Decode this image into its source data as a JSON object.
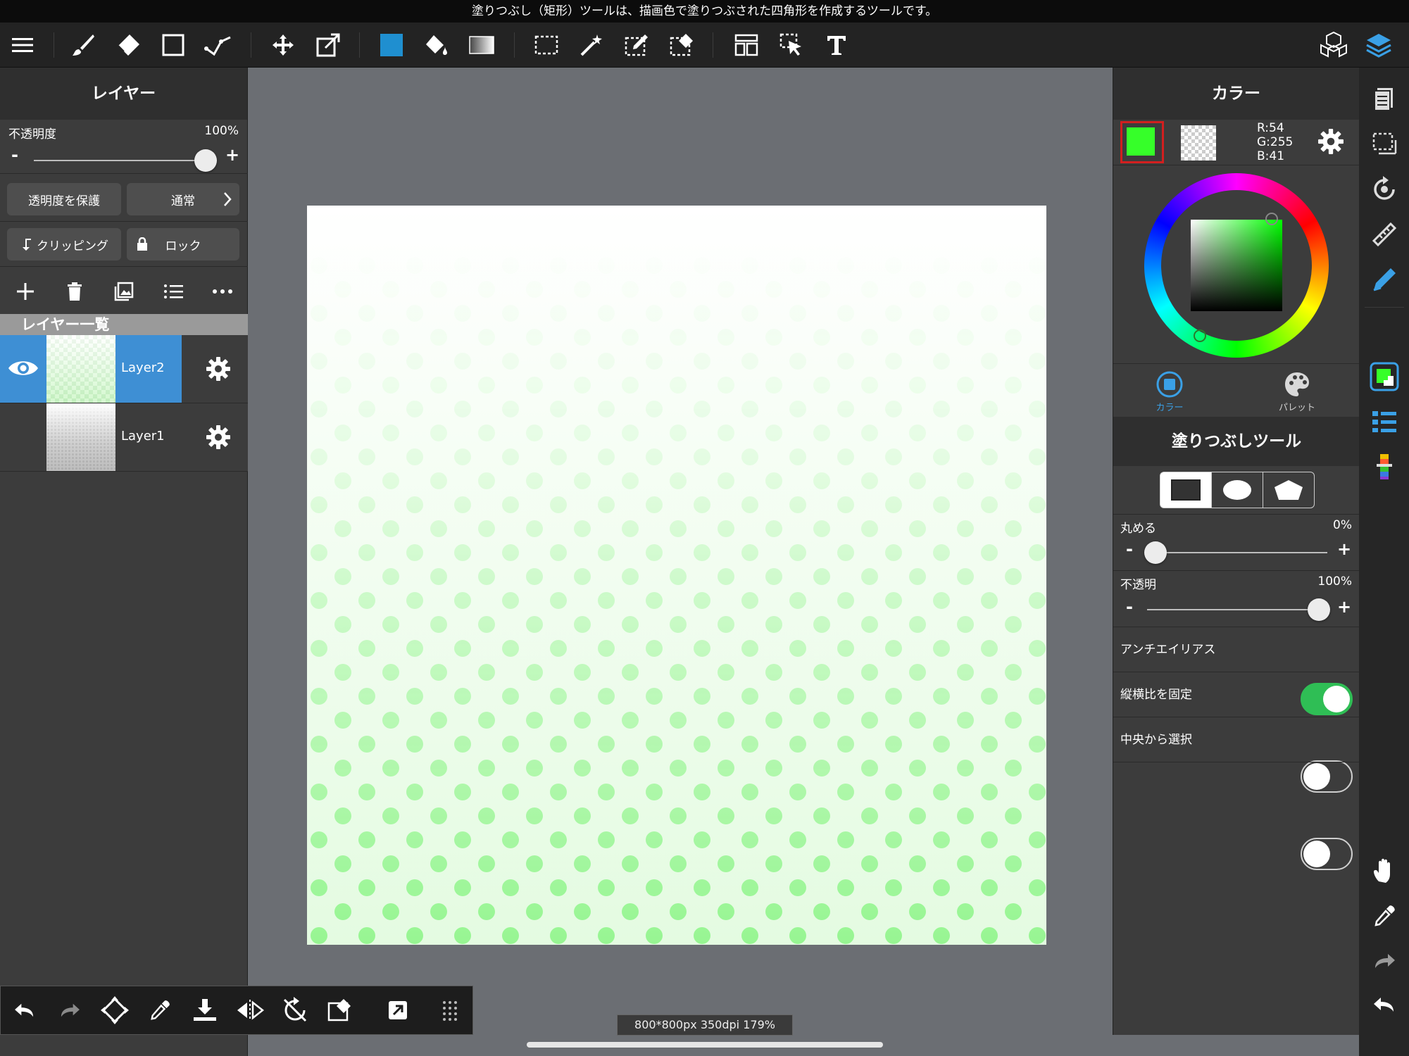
{
  "hint": "塗りつぶし（矩形）ツールは、描画色で塗りつぶされた四角形を作成するツールです。",
  "colors": {
    "accent": "#2f7fd3",
    "foreground": "#36ff29",
    "toggle_on": "#2fbe55",
    "panel": "#3c3c3c",
    "toolbar": "#232323"
  },
  "toolbar": {
    "icons": [
      "menu-icon",
      "brush-icon",
      "eraser-icon",
      "rectangle-icon",
      "select-stroke-icon",
      "move-icon",
      "transform-icon",
      "fill-color-swatch",
      "bucket-icon",
      "gradient-icon",
      "select-rect-icon",
      "magic-wand-icon",
      "select-pen-icon",
      "select-eraser-icon",
      "layout-icon",
      "pointer-icon",
      "text-icon",
      "materials-icon",
      "layers-icon"
    ]
  },
  "layer_panel": {
    "title": "レイヤー",
    "opacity_label": "不透明度",
    "opacity_value": "100%",
    "opacity": 1.0,
    "minus": "-",
    "plus": "+",
    "protect_alpha": "透明度を保護",
    "blend_mode": "通常",
    "clipping": "クリッピング",
    "lock": "ロック",
    "list_header": "レイヤー一覧",
    "layers": [
      {
        "name": "Layer2",
        "selected": true,
        "visible": true
      },
      {
        "name": "Layer1",
        "selected": false,
        "visible": false
      }
    ]
  },
  "color_panel": {
    "title": "カラー",
    "rgb": {
      "r": "R:54",
      "g": "G:255",
      "b": "B:41"
    },
    "tab_color": "カラー",
    "tab_palette": "パレット"
  },
  "fill_tool": {
    "title": "塗りつぶしツール",
    "round_label": "丸める",
    "round_value": "0%",
    "round": 0.0,
    "opacity_label": "不透明",
    "opacity_value": "100%",
    "opacity": 1.0,
    "antialias_label": "アンチエイリアス",
    "antialias": true,
    "fix_ratio_label": "縦横比を固定",
    "fix_ratio": false,
    "from_center_label": "中央から選択",
    "from_center": false,
    "minus": "-",
    "plus": "+"
  },
  "status": "800*800px 350dpi 179%"
}
